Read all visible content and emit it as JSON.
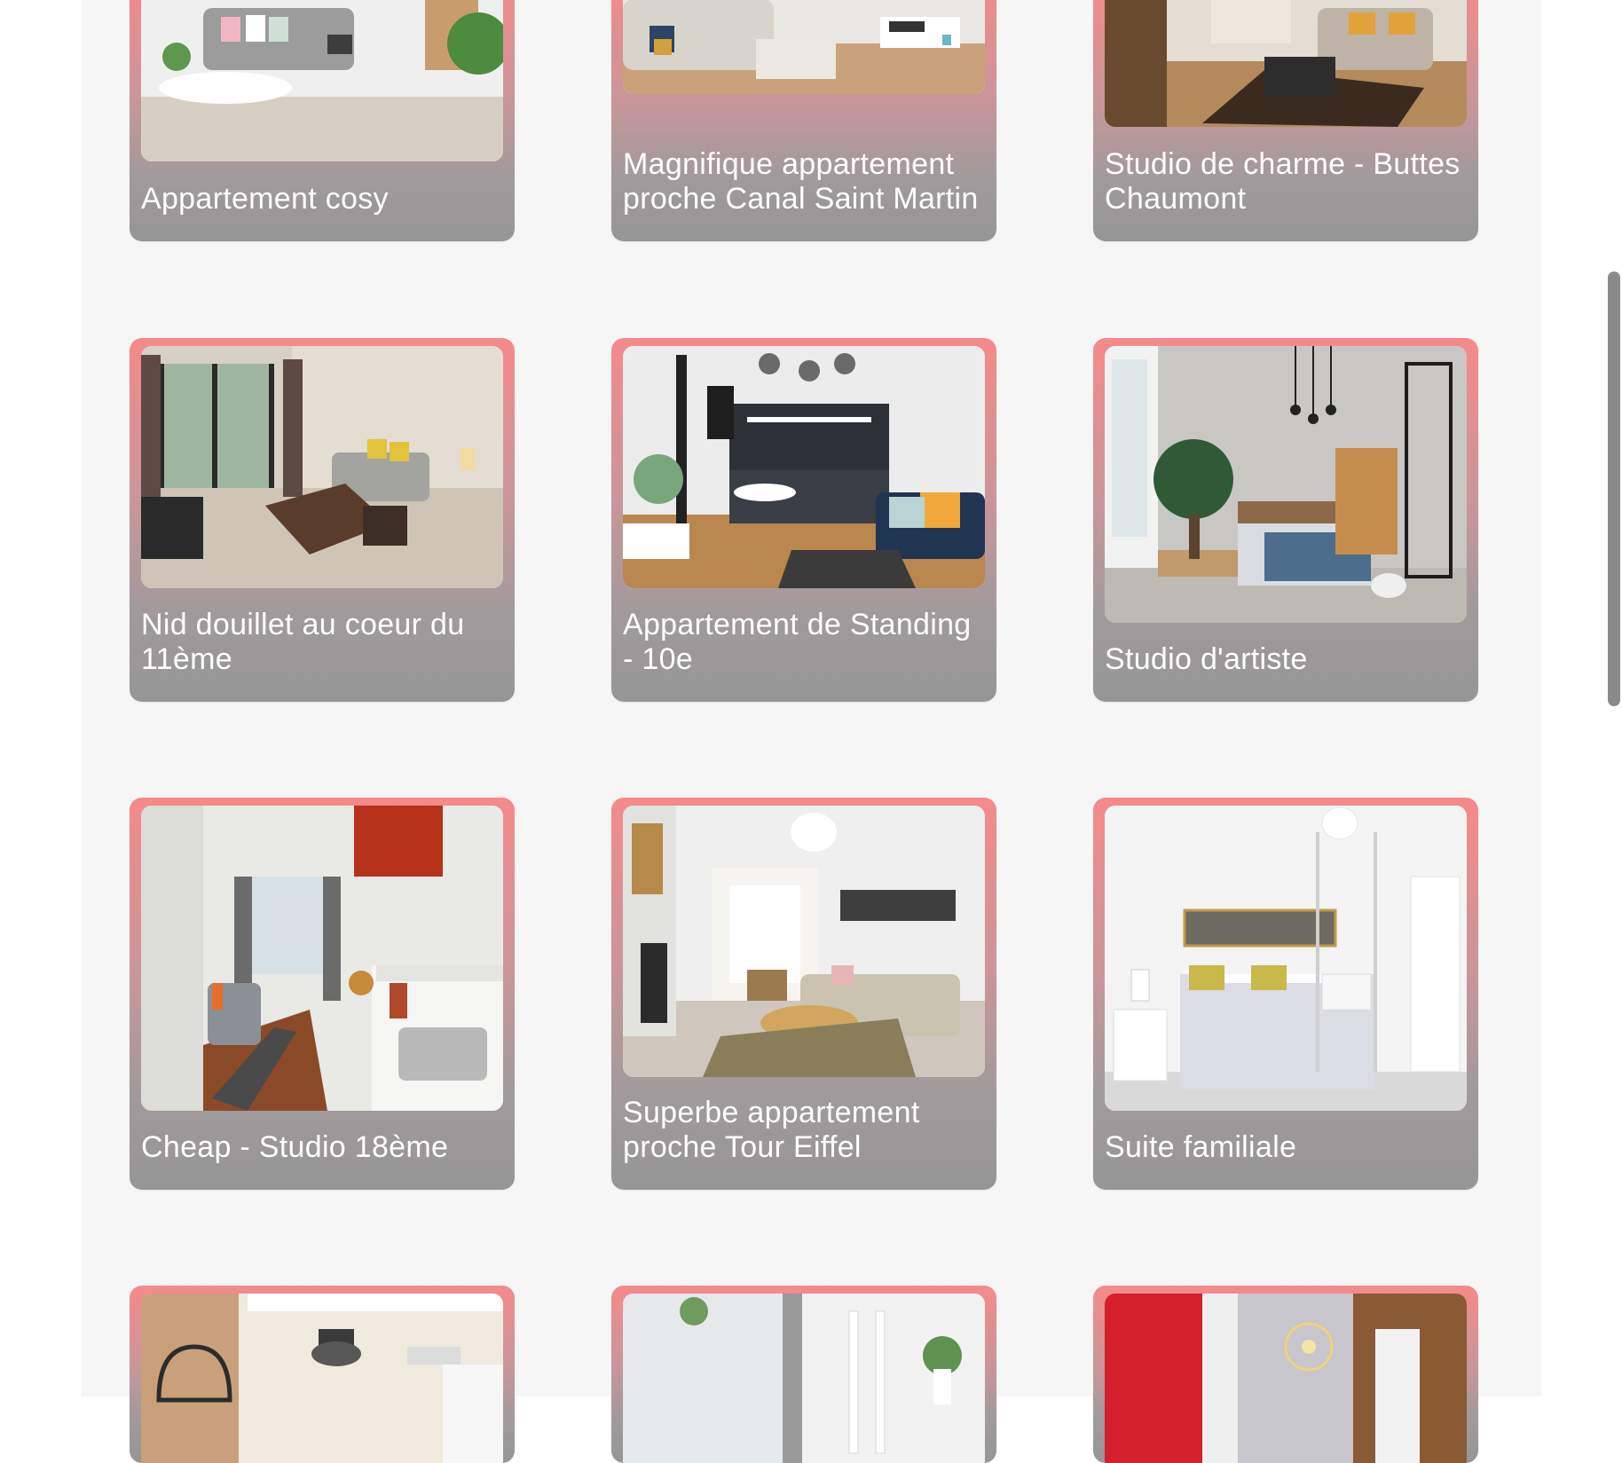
{
  "listings": [
    {
      "title": "Appartement cosy",
      "photo": "living-room-pink-cushions-photo"
    },
    {
      "title": "Magnifique appartement proche Canal Saint Martin",
      "photo": "living-room-beige-sofa-photo"
    },
    {
      "title": "Studio de charme - Buttes Chaumont",
      "photo": "living-room-rug-photo"
    },
    {
      "title": "Nid douillet au coeur du 11ème",
      "photo": "living-room-window-photo"
    },
    {
      "title": "Appartement de Standing - 10e",
      "photo": "open-kitchen-blue-sofa-photo"
    },
    {
      "title": "Studio d'artiste",
      "photo": "loft-bedroom-photo"
    },
    {
      "title": "Cheap - Studio 18ème",
      "photo": "studio-kitchen-photo"
    },
    {
      "title": "Superbe appartement proche Tour Eiffel",
      "photo": "living-room-panorama-photo"
    },
    {
      "title": "Suite familiale",
      "photo": "white-bedroom-photo"
    },
    {
      "title": "",
      "photo": "brick-wall-kitchen-photo"
    },
    {
      "title": "",
      "photo": "bright-room-plants-photo"
    },
    {
      "title": "",
      "photo": "red-wall-bedroom-photo"
    }
  ],
  "colors": {
    "page_background": "#f6f6f6",
    "card_accent": "#f58a8a",
    "card_bottom": "#969696",
    "title_text": "#ffffff"
  }
}
